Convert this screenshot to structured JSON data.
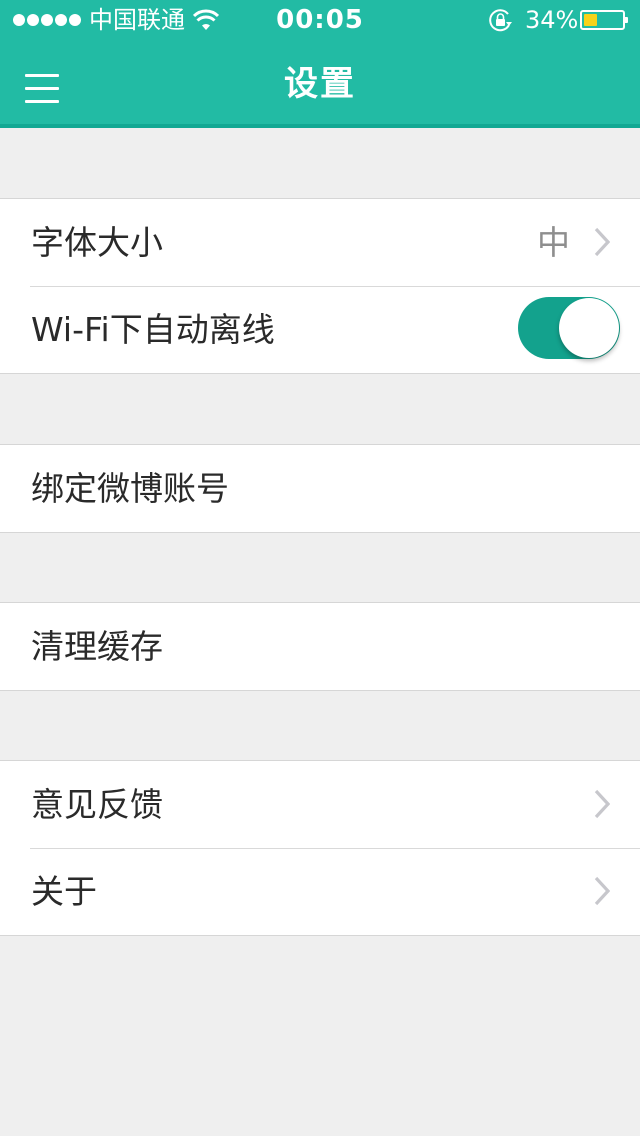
{
  "status_bar": {
    "carrier": "中国联通",
    "time": "00:05",
    "battery_percent": "34%",
    "battery_level": 0.34,
    "signal_bars": 5,
    "icons": [
      "signal-dots-icon",
      "wifi-icon",
      "orientation-lock-icon",
      "battery-icon"
    ]
  },
  "nav": {
    "title": "设置",
    "menu_icon": "hamburger-menu-icon"
  },
  "colors": {
    "header": "#22bba4",
    "header_accent": "#12a893",
    "toggle_on": "#13a28d",
    "battery_fill": "#f7d21a",
    "background": "#efefef"
  },
  "settings": {
    "font_size": {
      "label": "字体大小",
      "value": "中"
    },
    "wifi_offline": {
      "label": "Wi-Fi下自动离线",
      "enabled": true
    },
    "bind_weibo": {
      "label": "绑定微博账号"
    },
    "clear_cache": {
      "label": "清理缓存"
    },
    "feedback": {
      "label": "意见反馈"
    },
    "about": {
      "label": "关于"
    }
  }
}
